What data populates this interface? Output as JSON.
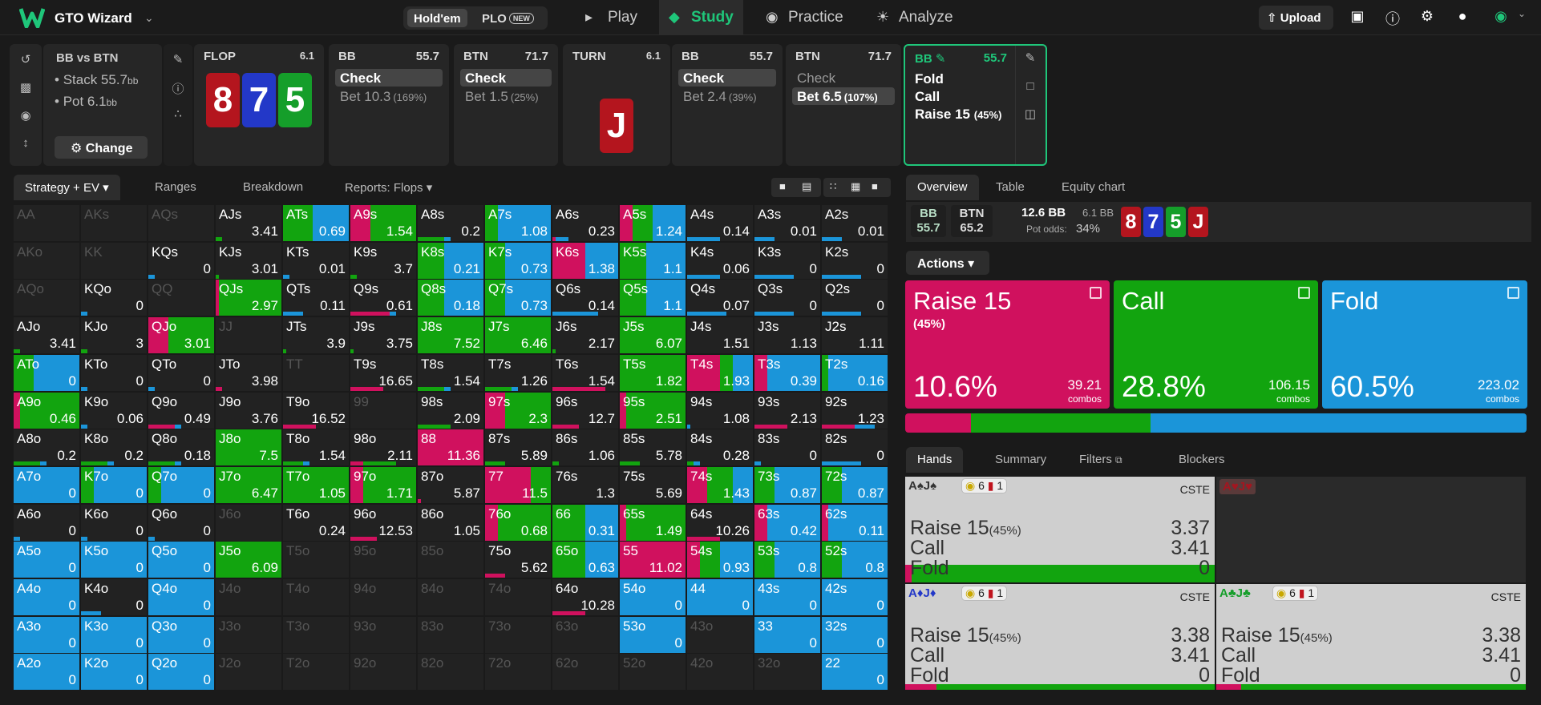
{
  "app": {
    "name": "GTO Wizard"
  },
  "game_toggle": {
    "holdem": "Hold'em",
    "plo": "PLO",
    "new_badge": "NEW"
  },
  "nav": [
    "Play",
    "Study",
    "Practice",
    "Analyze"
  ],
  "topright": {
    "upload": "Upload"
  },
  "spot_info": {
    "title": "BB vs BTN",
    "stack": "Stack 55.7",
    "stack_unit": "bb",
    "pot": "Pot 6.1",
    "pot_unit": "bb",
    "change": "Change"
  },
  "flop": {
    "label": "FLOP",
    "pot": "6.1",
    "cards": [
      {
        "r": "8",
        "color": "#b4151e"
      },
      {
        "r": "7",
        "color": "#2338c8"
      },
      {
        "r": "5",
        "color": "#159e2a"
      }
    ]
  },
  "turn": {
    "label": "TURN",
    "pot": "6.1",
    "card": {
      "r": "J",
      "color": "#b4151e"
    }
  },
  "spots": [
    {
      "name": "BB",
      "val": "55.7",
      "actions": [
        {
          "t": "Check",
          "p": "",
          "sel": true
        },
        {
          "t": "Bet 10.3",
          "p": "(169%)",
          "sel": false
        }
      ]
    },
    {
      "name": "BTN",
      "val": "71.7",
      "actions": [
        {
          "t": "Check",
          "p": "",
          "sel": true
        },
        {
          "t": "Bet 1.5",
          "p": "(25%)",
          "sel": false
        }
      ]
    },
    {
      "name": "BB",
      "val": "55.7",
      "actions": [
        {
          "t": "Check",
          "p": "",
          "sel": true
        },
        {
          "t": "Bet 2.4",
          "p": "(39%)",
          "sel": false
        }
      ]
    },
    {
      "name": "BTN",
      "val": "71.7",
      "actions": [
        {
          "t": "Check",
          "p": "",
          "sel": false
        },
        {
          "t": "Bet 6.5",
          "p": "(107%)",
          "sel": true
        }
      ]
    }
  ],
  "current_spot": {
    "name": "BB",
    "val": "55.7",
    "actions": [
      "Fold",
      "Call",
      "Raise 15"
    ],
    "raise_pct": "(45%)"
  },
  "left_tabs": [
    "Strategy + EV",
    "Ranges",
    "Breakdown",
    "Reports: Flops"
  ],
  "right_tabs": [
    "Overview",
    "Table",
    "Equity chart"
  ],
  "overview": {
    "bb_label": "BB",
    "bb_val": "55.7",
    "btn_label": "BTN",
    "btn_val": "65.2",
    "pot": "12.6 BB",
    "pot_sub": "6.1 BB",
    "odds_label": "Pot odds:",
    "odds": "34%"
  },
  "actions_btn": "Actions",
  "action_cards": [
    {
      "t": "Raise 15",
      "s": "(45%)",
      "pct": "10.6%",
      "combos": "39.21",
      "cl": "combos",
      "color": "#d0115e",
      "frac": 0.106
    },
    {
      "t": "Call",
      "s": "",
      "pct": "28.8%",
      "combos": "106.15",
      "cl": "combos",
      "color": "#12a40f",
      "frac": 0.288
    },
    {
      "t": "Fold",
      "s": "",
      "pct": "60.5%",
      "combos": "223.02",
      "cl": "combos",
      "color": "#1b95d9",
      "frac": 0.605
    }
  ],
  "hand_tabs": [
    "Hands",
    "Summary",
    "Filters",
    "Blockers"
  ],
  "hands": [
    {
      "cards": "A♠J♠",
      "suitcolor": "#333",
      "b1": "6",
      "b2": "1",
      "cste": "CSTE",
      "raise": "Raise 15",
      "rp": "(45%)",
      "rv": "3.37",
      "call": "Call",
      "cv": "3.41",
      "fold": "Fold",
      "fv": "0",
      "rf": 0.02,
      "cf": 0.98
    },
    {
      "cards": "A♥J♥",
      "suitcolor": "#a31620",
      "dark": true
    },
    {
      "cards": "A♦J♦",
      "suitcolor": "#2338c8",
      "b1": "6",
      "b2": "1",
      "cste": "CSTE",
      "raise": "Raise 15",
      "rp": "(45%)",
      "rv": "3.38",
      "call": "Call",
      "cv": "3.41",
      "fold": "Fold",
      "fv": "0",
      "rf": 0.1,
      "cf": 0.9
    },
    {
      "cards": "A♣J♣",
      "suitcolor": "#159e2a",
      "b1": "6",
      "b2": "1",
      "cste": "CSTE",
      "raise": "Raise 15",
      "rp": "(45%)",
      "rv": "3.38",
      "call": "Call",
      "cv": "3.41",
      "fold": "Fold",
      "fv": "0",
      "rf": 0.08,
      "cf": 0.92
    }
  ],
  "grid": [
    [
      [
        "AA",
        "",
        0,
        0,
        0
      ],
      [
        "AKs",
        "",
        0,
        0,
        0
      ],
      [
        "AQs",
        "",
        0,
        0,
        0
      ],
      [
        "AJs",
        "3.41",
        0,
        0.1,
        0
      ],
      [
        "ATs",
        "0.69",
        0,
        0.45,
        0.55
      ],
      [
        "A9s",
        "1.54",
        0.3,
        0.7,
        0
      ],
      [
        "A8s",
        "0.2",
        0,
        0.4,
        0.1
      ],
      [
        "A7s",
        "1.08",
        0,
        0.2,
        0.8
      ],
      [
        "A6s",
        "0.23",
        0.05,
        0,
        0.2
      ],
      [
        "A5s",
        "1.24",
        0.2,
        0.3,
        0.5
      ],
      [
        "A4s",
        "0.14",
        0,
        0,
        0.5
      ],
      [
        "A3s",
        "0.01",
        0,
        0,
        0.3
      ],
      [
        "A2s",
        "0.01",
        0,
        0,
        0.3
      ]
    ],
    [
      [
        "AKo",
        "",
        0,
        0,
        0
      ],
      [
        "KK",
        "",
        0,
        0,
        0
      ],
      [
        "KQs",
        "0",
        0,
        0,
        0.1
      ],
      [
        "KJs",
        "3.01",
        0,
        0.05,
        0
      ],
      [
        "KTs",
        "0.01",
        0,
        0,
        0.1
      ],
      [
        "K9s",
        "3.7",
        0,
        0.1,
        0
      ],
      [
        "K8s",
        "0.21",
        0,
        0.4,
        0.6
      ],
      [
        "K7s",
        "0.73",
        0,
        0.3,
        0.7
      ],
      [
        "K6s",
        "1.38",
        0.5,
        0,
        0.5
      ],
      [
        "K5s",
        "1.1",
        0,
        0.4,
        0.6
      ],
      [
        "K4s",
        "0.06",
        0,
        0,
        0.5
      ],
      [
        "K3s",
        "0",
        0,
        0,
        0.6
      ],
      [
        "K2s",
        "0",
        0,
        0,
        0.6
      ]
    ],
    [
      [
        "AQo",
        "",
        0,
        0,
        0
      ],
      [
        "KQo",
        "0",
        0,
        0,
        0.1
      ],
      [
        "QQ",
        "",
        0,
        0,
        0
      ],
      [
        "QJs",
        "2.97",
        0.05,
        0.95,
        0
      ],
      [
        "QTs",
        "0.11",
        0,
        0,
        0.3
      ],
      [
        "Q9s",
        "0.61",
        0.6,
        0,
        0.1
      ],
      [
        "Q8s",
        "0.18",
        0,
        0.4,
        0.6
      ],
      [
        "Q7s",
        "0.73",
        0,
        0.3,
        0.7
      ],
      [
        "Q6s",
        "0.14",
        0,
        0,
        0.7
      ],
      [
        "Q5s",
        "1.1",
        0,
        0.4,
        0.6
      ],
      [
        "Q4s",
        "0.07",
        0,
        0,
        0.6
      ],
      [
        "Q3s",
        "0",
        0,
        0,
        0.6
      ],
      [
        "Q2s",
        "0",
        0,
        0,
        0.6
      ]
    ],
    [
      [
        "AJo",
        "3.41",
        0,
        0.1,
        0
      ],
      [
        "KJo",
        "3",
        0,
        0.1,
        0
      ],
      [
        "QJo",
        "3.01",
        0.3,
        0.7,
        0
      ],
      [
        "JJ",
        "",
        0,
        0,
        0
      ],
      [
        "JTs",
        "3.9",
        0,
        0.05,
        0
      ],
      [
        "J9s",
        "3.75",
        0,
        0.05,
        0
      ],
      [
        "J8s",
        "7.52",
        0,
        1,
        0
      ],
      [
        "J7s",
        "6.46",
        0,
        1,
        0
      ],
      [
        "J6s",
        "2.17",
        0,
        0.05,
        0
      ],
      [
        "J5s",
        "6.07",
        0,
        1,
        0
      ],
      [
        "J4s",
        "1.51",
        0,
        0,
        0
      ],
      [
        "J3s",
        "1.13",
        0,
        0,
        0
      ],
      [
        "J2s",
        "1.11",
        0,
        0,
        0
      ]
    ],
    [
      [
        "ATo",
        "0",
        0,
        0.3,
        0.7
      ],
      [
        "KTo",
        "0",
        0,
        0,
        0.1
      ],
      [
        "QTo",
        "0",
        0,
        0,
        0.1
      ],
      [
        "JTo",
        "3.98",
        0.1,
        0,
        0
      ],
      [
        "TT",
        "",
        0,
        0,
        0
      ],
      [
        "T9s",
        "16.65",
        0.5,
        0,
        0
      ],
      [
        "T8s",
        "1.54",
        0,
        0.4,
        0.1
      ],
      [
        "T7s",
        "1.26",
        0,
        0.4,
        0.1
      ],
      [
        "T6s",
        "1.54",
        0.8,
        0,
        0
      ],
      [
        "T5s",
        "1.82",
        0,
        1,
        0
      ],
      [
        "T4s",
        "1.93",
        0.5,
        0.2,
        0.3
      ],
      [
        "T3s",
        "0.39",
        0.2,
        0,
        0.8
      ],
      [
        "T2s",
        "0.16",
        0,
        0.1,
        0.9
      ]
    ],
    [
      [
        "A9o",
        "0.46",
        0.1,
        0.9,
        0
      ],
      [
        "K9o",
        "0.06",
        0,
        0,
        0.1
      ],
      [
        "Q9o",
        "0.49",
        0.4,
        0,
        0.1
      ],
      [
        "J9o",
        "3.76",
        0,
        0,
        0
      ],
      [
        "T9o",
        "16.52",
        0.5,
        0,
        0
      ],
      [
        "99",
        "",
        0,
        0,
        0
      ],
      [
        "98s",
        "2.09",
        0,
        0.5,
        0
      ],
      [
        "97s",
        "2.3",
        0.3,
        0.7,
        0
      ],
      [
        "96s",
        "12.7",
        0.4,
        0,
        0
      ],
      [
        "95s",
        "2.51",
        0.1,
        0.9,
        0
      ],
      [
        "94s",
        "1.08",
        0,
        0,
        0.05
      ],
      [
        "93s",
        "2.13",
        0.5,
        0,
        0
      ],
      [
        "92s",
        "1.23",
        0.5,
        0,
        0.3
      ]
    ],
    [
      [
        "A8o",
        "0.2",
        0,
        0.4,
        0.1
      ],
      [
        "K8o",
        "0.2",
        0,
        0.4,
        0.1
      ],
      [
        "Q8o",
        "0.18",
        0,
        0.4,
        0.1
      ],
      [
        "J8o",
        "7.5",
        0,
        1,
        0
      ],
      [
        "T8o",
        "1.54",
        0,
        0.3,
        0.1
      ],
      [
        "98o",
        "2.11",
        0.2,
        0.5,
        0
      ],
      [
        "88",
        "11.36",
        1,
        0,
        0
      ],
      [
        "87s",
        "5.89",
        0,
        0.3,
        0
      ],
      [
        "86s",
        "1.06",
        0,
        0.1,
        0
      ],
      [
        "85s",
        "5.78",
        0,
        0.3,
        0
      ],
      [
        "84s",
        "0.28",
        0,
        0.1,
        0.1
      ],
      [
        "83s",
        "0",
        0,
        0,
        0.1
      ],
      [
        "82s",
        "0",
        0,
        0,
        0.6
      ]
    ],
    [
      [
        "A7o",
        "0",
        0,
        0,
        1
      ],
      [
        "K7o",
        "0",
        0,
        0.2,
        0.8
      ],
      [
        "Q7o",
        "0",
        0,
        0.2,
        0.8
      ],
      [
        "J7o",
        "6.47",
        0,
        1,
        0
      ],
      [
        "T7o",
        "1.05",
        0,
        1,
        0
      ],
      [
        "97o",
        "1.71",
        0.2,
        0.8,
        0
      ],
      [
        "87o",
        "5.87",
        0.05,
        0,
        0
      ],
      [
        "77",
        "11.5",
        0.7,
        0.3,
        0
      ],
      [
        "76s",
        "1.3",
        0,
        0,
        0
      ],
      [
        "75s",
        "5.69",
        0,
        0,
        0
      ],
      [
        "74s",
        "1.43",
        0.3,
        0.4,
        0.3
      ],
      [
        "73s",
        "0.87",
        0,
        0.3,
        0.7
      ],
      [
        "72s",
        "0.87",
        0,
        0.3,
        0.7
      ]
    ],
    [
      [
        "A6o",
        "0",
        0,
        0,
        0.1
      ],
      [
        "K6o",
        "0",
        0,
        0,
        0.1
      ],
      [
        "Q6o",
        "0",
        0,
        0,
        0.1
      ],
      [
        "J6o",
        "",
        0,
        0,
        0
      ],
      [
        "T6o",
        "0.24",
        0,
        0,
        0
      ],
      [
        "96o",
        "12.53",
        0.4,
        0,
        0
      ],
      [
        "86o",
        "1.05",
        0,
        0,
        0
      ],
      [
        "76o",
        "0.68",
        0.2,
        0.8,
        0
      ],
      [
        "66",
        "0.31",
        0,
        0.5,
        0.5
      ],
      [
        "65s",
        "1.49",
        0.1,
        0.9,
        0
      ],
      [
        "64s",
        "10.26",
        0.5,
        0,
        0
      ],
      [
        "63s",
        "0.42",
        0.2,
        0,
        0.8
      ],
      [
        "62s",
        "0.11",
        0.1,
        0,
        0.9
      ]
    ],
    [
      [
        "A5o",
        "0",
        0,
        0,
        1
      ],
      [
        "K5o",
        "0",
        0,
        0,
        1
      ],
      [
        "Q5o",
        "0",
        0,
        0,
        1
      ],
      [
        "J5o",
        "6.09",
        0,
        1,
        0
      ],
      [
        "T5o",
        "",
        0,
        0,
        0
      ],
      [
        "95o",
        "",
        0,
        0,
        0
      ],
      [
        "85o",
        "",
        0,
        0,
        0
      ],
      [
        "75o",
        "5.62",
        0.3,
        0,
        0
      ],
      [
        "65o",
        "0.63",
        0,
        0.5,
        0.5
      ],
      [
        "55",
        "11.02",
        1,
        0,
        0
      ],
      [
        "54s",
        "0.93",
        0.2,
        0.3,
        0.5
      ],
      [
        "53s",
        "0.8",
        0,
        0.3,
        0.7
      ],
      [
        "52s",
        "0.8",
        0,
        0.3,
        0.7
      ]
    ],
    [
      [
        "A4o",
        "0",
        0,
        0,
        1
      ],
      [
        "K4o",
        "0",
        0,
        0,
        0.3
      ],
      [
        "Q4o",
        "0",
        0,
        0,
        1
      ],
      [
        "J4o",
        "",
        0,
        0,
        0
      ],
      [
        "T4o",
        "",
        0,
        0,
        0
      ],
      [
        "94o",
        "",
        0,
        0,
        0
      ],
      [
        "84o",
        "",
        0,
        0,
        0
      ],
      [
        "74o",
        "",
        0,
        0,
        0
      ],
      [
        "64o",
        "10.28",
        0.5,
        0,
        0
      ],
      [
        "54o",
        "0",
        0,
        0,
        1
      ],
      [
        "44",
        "0",
        0,
        0,
        1
      ],
      [
        "43s",
        "0",
        0,
        0,
        1
      ],
      [
        "42s",
        "0",
        0,
        0,
        1
      ]
    ],
    [
      [
        "A3o",
        "0",
        0,
        0,
        1
      ],
      [
        "K3o",
        "0",
        0,
        0,
        1
      ],
      [
        "Q3o",
        "0",
        0,
        0,
        1
      ],
      [
        "J3o",
        "",
        0,
        0,
        0
      ],
      [
        "T3o",
        "",
        0,
        0,
        0
      ],
      [
        "93o",
        "",
        0,
        0,
        0
      ],
      [
        "83o",
        "",
        0,
        0,
        0
      ],
      [
        "73o",
        "",
        0,
        0,
        0
      ],
      [
        "63o",
        "",
        0,
        0,
        0
      ],
      [
        "53o",
        "0",
        0,
        0,
        1
      ],
      [
        "43o",
        "",
        0,
        0,
        0
      ],
      [
        "33",
        "0",
        0,
        0,
        1
      ],
      [
        "32s",
        "0",
        0,
        0,
        1
      ]
    ],
    [
      [
        "A2o",
        "0",
        0,
        0,
        1
      ],
      [
        "K2o",
        "0",
        0,
        0,
        1
      ],
      [
        "Q2o",
        "0",
        0,
        0,
        1
      ],
      [
        "J2o",
        "",
        0,
        0,
        0
      ],
      [
        "T2o",
        "",
        0,
        0,
        0
      ],
      [
        "92o",
        "",
        0,
        0,
        0
      ],
      [
        "82o",
        "",
        0,
        0,
        0
      ],
      [
        "72o",
        "",
        0,
        0,
        0
      ],
      [
        "62o",
        "",
        0,
        0,
        0
      ],
      [
        "52o",
        "",
        0,
        0,
        0
      ],
      [
        "42o",
        "",
        0,
        0,
        0
      ],
      [
        "32o",
        "",
        0,
        0,
        0
      ],
      [
        "22",
        "0",
        0,
        0,
        1
      ]
    ]
  ]
}
